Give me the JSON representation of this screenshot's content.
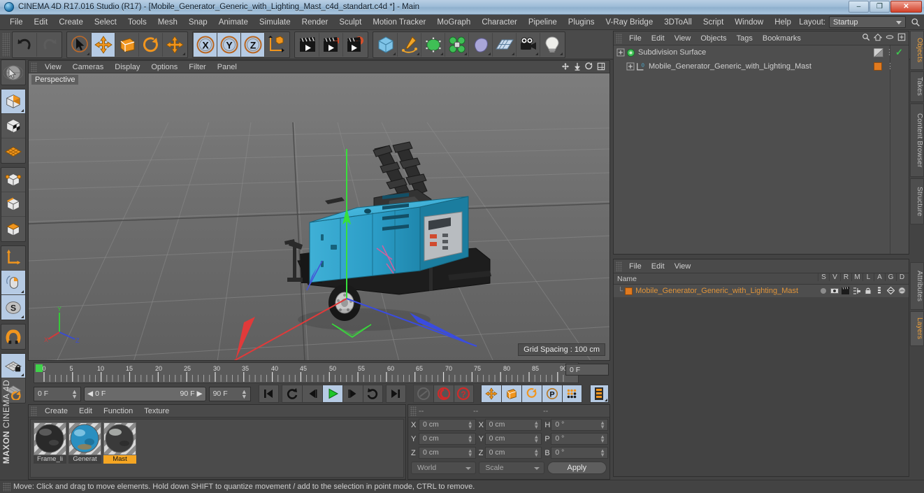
{
  "window": {
    "title": "CINEMA 4D R17.016 Studio (R17) - [Mobile_Generator_Generic_with_Lighting_Mast_c4d_standart.c4d *] - Main",
    "app_icon": "cinema4d-logo-icon",
    "minimize": "–",
    "restore": "❐",
    "close": "✕"
  },
  "menubar": {
    "items": [
      {
        "label": "File"
      },
      {
        "label": "Edit"
      },
      {
        "label": "Create"
      },
      {
        "label": "Select"
      },
      {
        "label": "Tools"
      },
      {
        "label": "Mesh"
      },
      {
        "label": "Snap"
      },
      {
        "label": "Animate"
      },
      {
        "label": "Simulate"
      },
      {
        "label": "Render"
      },
      {
        "label": "Sculpt"
      },
      {
        "label": "Motion Tracker"
      },
      {
        "label": "MoGraph"
      },
      {
        "label": "Character"
      },
      {
        "label": "Pipeline"
      },
      {
        "label": "Plugins"
      },
      {
        "label": "V-Ray Bridge"
      },
      {
        "label": "3DToAll"
      },
      {
        "label": "Script"
      },
      {
        "label": "Window"
      },
      {
        "label": "Help"
      }
    ],
    "layout_label": "Layout:",
    "layout_value": "Startup",
    "search_icon": "search-icon"
  },
  "toolbar": {
    "groups": [
      {
        "name": "undo-redo",
        "buttons": [
          {
            "name": "undo-button",
            "icon": "undo-arrow-icon",
            "state": "enabled"
          },
          {
            "name": "redo-button",
            "icon": "redo-arrow-icon",
            "state": "disabled"
          }
        ]
      },
      {
        "name": "transform-tools",
        "buttons": [
          {
            "name": "select-tool",
            "icon": "cursor-arrow-icon",
            "state": "enabled"
          },
          {
            "name": "move-tool",
            "icon": "move-cross-icon",
            "state": "active"
          },
          {
            "name": "scale-tool",
            "icon": "scale-box-icon",
            "state": "enabled"
          },
          {
            "name": "rotate-tool",
            "icon": "rotate-circle-icon",
            "state": "enabled"
          },
          {
            "name": "move-alt-tool",
            "icon": "move-cross-icon",
            "state": "enabled"
          }
        ]
      },
      {
        "name": "axis-locks",
        "buttons": [
          {
            "name": "lock-x-axis",
            "icon": "x-axis-icon",
            "state": "active"
          },
          {
            "name": "lock-y-axis",
            "icon": "y-axis-icon",
            "state": "active"
          },
          {
            "name": "lock-z-axis",
            "icon": "z-axis-icon",
            "state": "active"
          },
          {
            "name": "world-object-coord-toggle",
            "icon": "world-axis-cube-icon",
            "state": "enabled"
          }
        ]
      },
      {
        "name": "render-tools",
        "buttons": [
          {
            "name": "render-view-button",
            "icon": "clapperboard-icon",
            "state": "enabled"
          },
          {
            "name": "render-to-picture-viewer-button",
            "icon": "clapperboard-window-icon",
            "state": "enabled"
          },
          {
            "name": "render-settings-button",
            "icon": "clapperboard-gear-icon",
            "state": "enabled"
          }
        ]
      },
      {
        "name": "create-objects",
        "buttons": [
          {
            "name": "add-cube-button",
            "icon": "blue-cube-icon",
            "state": "enabled"
          },
          {
            "name": "add-spline-button",
            "icon": "pen-spline-icon",
            "state": "enabled"
          },
          {
            "name": "add-generator-button",
            "icon": "green-cube-generator-icon",
            "state": "enabled"
          },
          {
            "name": "add-deformer-button",
            "icon": "green-deformer-icon",
            "state": "enabled"
          },
          {
            "name": "add-environment-button",
            "icon": "environment-sky-icon",
            "state": "enabled"
          },
          {
            "name": "add-scene-button",
            "icon": "scene-floor-icon",
            "state": "enabled"
          },
          {
            "name": "add-camera-button",
            "icon": "camera-icon",
            "state": "enabled"
          },
          {
            "name": "add-light-button",
            "icon": "light-bulb-icon",
            "state": "enabled"
          }
        ]
      }
    ]
  },
  "left_toolbar": {
    "buttons": [
      {
        "name": "live-selection-tool",
        "icon": "sphere-selection-icon",
        "state": "enabled"
      },
      {
        "name": "make-editable-tool",
        "icon": "editable-cube-icon",
        "state": "active"
      },
      {
        "name": "model-mode-tool",
        "icon": "checker-cube-icon",
        "state": "enabled"
      },
      {
        "name": "texture-mode-tool",
        "icon": "texture-grid-icon",
        "state": "enabled"
      },
      {
        "name": "points-mode-tool",
        "icon": "points-cube-icon",
        "state": "enabled"
      },
      {
        "name": "edges-mode-tool",
        "icon": "edges-cube-icon",
        "state": "enabled"
      },
      {
        "name": "polygons-mode-tool",
        "icon": "polygons-cube-icon",
        "state": "enabled"
      },
      {
        "name": "axis-modify-tool",
        "icon": "axis-corner-icon",
        "state": "enabled"
      },
      {
        "name": "enable-tweak-tool",
        "icon": "mouse-tweak-icon",
        "state": "active"
      },
      {
        "name": "soft-selection-tool",
        "icon": "soft-selection-s-icon",
        "state": "active"
      },
      {
        "name": "snap-magnet-tool",
        "icon": "magnet-icon",
        "state": "enabled"
      },
      {
        "name": "workplane-lock-tool",
        "icon": "workplane-lock-icon",
        "state": "active"
      },
      {
        "name": "workplane-rotate-tool",
        "icon": "workplane-rotate-icon",
        "state": "enabled"
      }
    ],
    "brand_top": "MAXON",
    "brand_bottom": "CINEMA 4D"
  },
  "viewport": {
    "menu": [
      {
        "label": "View"
      },
      {
        "label": "Cameras"
      },
      {
        "label": "Display"
      },
      {
        "label": "Options"
      },
      {
        "label": "Filter"
      },
      {
        "label": "Panel"
      }
    ],
    "corner_icons": [
      {
        "name": "move-view-icon"
      },
      {
        "name": "scale-view-icon"
      },
      {
        "name": "rotate-view-icon"
      },
      {
        "name": "maximize-view-icon"
      }
    ],
    "perspective_label": "Perspective",
    "grid_spacing_label": "Grid Spacing : 100 cm",
    "axis_gizmo": {
      "x": "X",
      "y": "Y",
      "z": "Z"
    },
    "scene_description": "Blue mobile diesel generator on a single-axle trailer with a folded lighting mast, selected with the move gizmo at its origin"
  },
  "timeline": {
    "ticks": [
      "0",
      "5",
      "10",
      "15",
      "20",
      "25",
      "30",
      "35",
      "40",
      "45",
      "50",
      "55",
      "60",
      "65",
      "70",
      "75",
      "80",
      "85",
      "90"
    ],
    "current_frame_field": "0 F",
    "range_start_field": "0 F",
    "scrub_left": "0 F",
    "scrub_right": "90 F",
    "range_end_field": "90 F",
    "transport": [
      {
        "name": "go-to-start-button",
        "icon": "skip-start-icon"
      },
      {
        "name": "play-backwards-loop-button",
        "icon": "loop-back-icon"
      },
      {
        "name": "step-back-button",
        "icon": "step-back-icon"
      },
      {
        "name": "play-button",
        "icon": "play-icon",
        "state": "active"
      },
      {
        "name": "step-forward-button",
        "icon": "step-forward-icon"
      },
      {
        "name": "loop-forward-button",
        "icon": "loop-forward-icon"
      },
      {
        "name": "go-to-end-button",
        "icon": "skip-end-icon"
      }
    ],
    "record_group": [
      {
        "name": "autokey-toggle",
        "icon": "autokey-icon",
        "state": "disabled"
      },
      {
        "name": "record-active-objects-button",
        "icon": "record-circle-icon"
      },
      {
        "name": "keyframe-selection-button",
        "icon": "question-key-icon"
      }
    ],
    "key_group": [
      {
        "name": "record-position-toggle",
        "icon": "position-move-icon",
        "state": "active"
      },
      {
        "name": "record-scale-toggle",
        "icon": "scale-key-icon",
        "state": "active"
      },
      {
        "name": "record-rotation-toggle",
        "icon": "rotation-key-icon",
        "state": "active"
      },
      {
        "name": "record-parameter-toggle",
        "icon": "parameter-p-icon",
        "state": "active"
      },
      {
        "name": "record-pla-toggle",
        "icon": "point-level-animation-icon",
        "state": "active"
      }
    ],
    "layer_button": {
      "name": "timeline-layer-button",
      "icon": "timeline-bars-icon",
      "state": "active"
    }
  },
  "material_manager": {
    "menu": [
      {
        "label": "Create"
      },
      {
        "label": "Edit"
      },
      {
        "label": "Function"
      },
      {
        "label": "Texture"
      }
    ],
    "materials": [
      {
        "name": "Frame_li",
        "selected": false
      },
      {
        "name": "Generat",
        "selected": false
      },
      {
        "name": "Mast",
        "selected": true
      }
    ]
  },
  "coordinates": {
    "headers": [
      "--",
      "--",
      "--"
    ],
    "position": {
      "label_x": "X",
      "x": "0 cm",
      "label_y": "Y",
      "y": "0 cm",
      "label_z": "Z",
      "z": "0 cm"
    },
    "size": {
      "label_x": "X",
      "x": "0 cm",
      "label_y": "Y",
      "y": "0 cm",
      "label_z": "Z",
      "z": "0 cm"
    },
    "rotation": {
      "label_h": "H",
      "h": "0 °",
      "label_p": "P",
      "p": "0 °",
      "label_b": "B",
      "b": "0 °"
    },
    "coord_system": "World",
    "size_mode": "Scale",
    "apply_label": "Apply"
  },
  "object_manager": {
    "menu": [
      {
        "label": "File"
      },
      {
        "label": "Edit"
      },
      {
        "label": "View"
      },
      {
        "label": "Objects"
      },
      {
        "label": "Tags"
      },
      {
        "label": "Bookmarks"
      }
    ],
    "header_icons": [
      {
        "name": "om-search-icon"
      },
      {
        "name": "om-home-icon"
      },
      {
        "name": "om-collapse-icon"
      },
      {
        "name": "om-expand-icon"
      }
    ],
    "rows": [
      {
        "name": "Subdivision Surface",
        "icon": "subdivision-surface-icon",
        "indent": 0,
        "tags": [
          "phong-tag",
          "visible-check"
        ]
      },
      {
        "name": "Mobile_Generator_Generic_with_Lighting_Mast",
        "icon": "null-object-icon",
        "indent": 1,
        "tags": [
          "orange-material-tag"
        ]
      }
    ]
  },
  "layer_manager": {
    "menu": [
      {
        "label": "File"
      },
      {
        "label": "Edit"
      },
      {
        "label": "View"
      }
    ],
    "name_column": "Name",
    "columns": [
      "S",
      "V",
      "R",
      "M",
      "L",
      "A",
      "G",
      "D"
    ],
    "rows": [
      {
        "name": "Mobile_Generator_Generic_with_Lighting_Mast",
        "color": "#e07a1f"
      }
    ]
  },
  "vertical_tabs": {
    "right_top": [
      {
        "label": "Objects",
        "selected": true
      },
      {
        "label": "Takes",
        "selected": false
      },
      {
        "label": "Content Browser",
        "selected": false
      },
      {
        "label": "Structure",
        "selected": false
      }
    ],
    "right_bottom": [
      {
        "label": "Attributes",
        "selected": false
      },
      {
        "label": "Layers",
        "selected": true
      }
    ]
  },
  "statusbar": {
    "message": "Move: Click and drag to move elements. Hold down SHIFT to quantize movement / add to the selection in point mode, CTRL to remove."
  },
  "colors": {
    "accent_orange": "#e07a1f",
    "selected_blue": "#b6cbe4",
    "panel_bg": "#434343",
    "viewport_gray": "#6f6f6f",
    "model_blue": "#2e9fc9",
    "axis_x_red": "#e03a3a",
    "axis_y_green": "#3ae03a",
    "axis_z_blue": "#3a3ae0"
  }
}
